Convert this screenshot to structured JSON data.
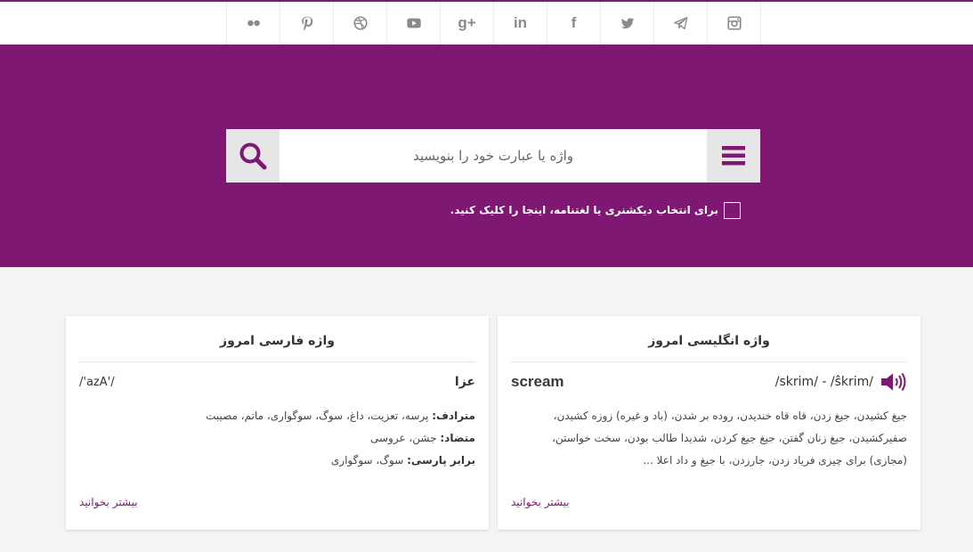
{
  "social": [
    {
      "name": "flickr-icon"
    },
    {
      "name": "pinterest-icon"
    },
    {
      "name": "dribbble-icon"
    },
    {
      "name": "youtube-icon"
    },
    {
      "name": "google-plus-icon",
      "label": "g+"
    },
    {
      "name": "linkedin-icon",
      "label": "in"
    },
    {
      "name": "facebook-icon",
      "label": "f"
    },
    {
      "name": "twitter-icon"
    },
    {
      "name": "telegram-icon"
    },
    {
      "name": "instagram-icon"
    }
  ],
  "colors": {
    "brand": "#7e1872",
    "background": "#f4f4f4",
    "icon_gray": "#8a8a8a"
  },
  "search": {
    "placeholder": "واژه یا عبارت خود را بنویسید",
    "value": "",
    "menu_icon": "hamburger-icon",
    "search_icon": "search-icon"
  },
  "dictionary_selector": {
    "label": "برای انتخاب دیکشنری یا لغتنامه، اینجا را کلیک کنید."
  },
  "english_word": {
    "title": "واژه انگلیسی امروز",
    "word": "scream",
    "pronunciation": "/skrim/ - /ŝkrim/",
    "speaker_icon": "speaker-icon",
    "definition": "جیغ کشیدن، جیغ زدن، قاه قاه خندیدن، روده بر شدن، (باد و غیره) زوزه کشیدن، صفیرکشیدن، جیغ زنان گفتن، جیغ جیغ کردن، شدیدا طالب بودن، سخت خواستن، (مجازی) برای چیزی فریاد زدن، جارزدن، با جیغ و داد اعلا ...",
    "more_label": "بیشتر بخوانید"
  },
  "persian_word": {
    "title": "واژه فارسی امروز",
    "word": "عزا",
    "pronunciation": "/'azA'/",
    "synonym_label": "مترادف:",
    "synonyms": " پرسه، تعزیت، داغ، سوگ، سوگواری، ماتم، مصیبت",
    "antonym_label": "متضاد:",
    "antonyms": " جشن، عروسی",
    "parsi_label": "برابر پارسی:",
    "parsi": " سوگ، سوگواری",
    "more_label": "بیشتر بخوانید"
  }
}
